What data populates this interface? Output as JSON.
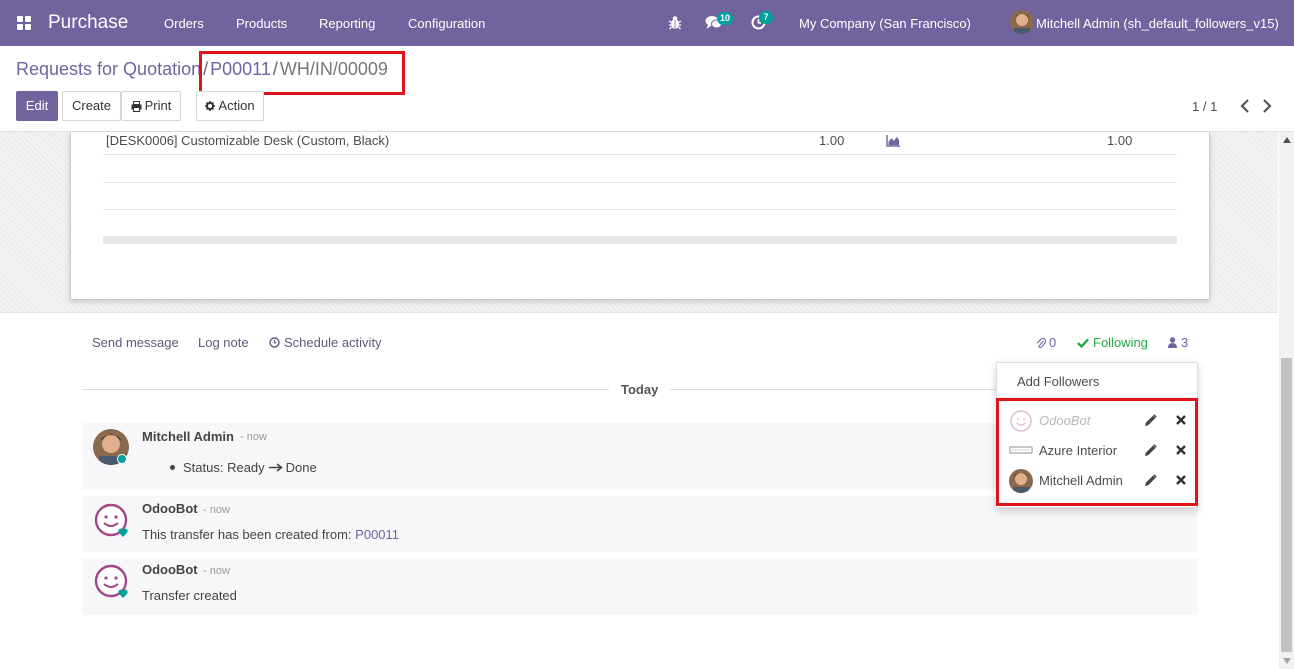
{
  "navbar": {
    "app_name": "Purchase",
    "menu": [
      "Orders",
      "Products",
      "Reporting",
      "Configuration"
    ],
    "messages_badge": "10",
    "activities_badge": "7",
    "company": "My Company (San Francisco)",
    "user": "Mitchell Admin (sh_default_followers_v15)",
    "icons": [
      "apps-icon",
      "bug-icon",
      "chat-icon",
      "clock-icon"
    ]
  },
  "breadcrumb": {
    "root": "Requests for Quotation",
    "parent": "P00011",
    "current": "WH/IN/00009",
    "separator": "/"
  },
  "toolbar": {
    "edit": "Edit",
    "create": "Create",
    "print": "Print",
    "action": "Action"
  },
  "pager": {
    "value": "1 / 1"
  },
  "lines": [
    {
      "product": "[DESK0006] Customizable Desk (Custom, Black)",
      "qty_demand": "1.00",
      "qty_done": "1.00"
    }
  ],
  "chatter": {
    "send_message": "Send message",
    "log_note": "Log note",
    "schedule_activity": "Schedule activity",
    "attachments_count": "0",
    "following_label": "Following",
    "followers_count": "3",
    "date_separator": "Today",
    "messages": [
      {
        "author": "Mitchell Admin",
        "time": "- now",
        "status_text": "Status: Ready",
        "status_new": "Done"
      },
      {
        "author": "OdooBot",
        "time": "- now",
        "body": "This transfer has been created from:",
        "link": "P00011"
      },
      {
        "author": "OdooBot",
        "time": "- now",
        "body": "Transfer created"
      }
    ]
  },
  "followers_dropdown": {
    "add_followers": "Add Followers",
    "followers": [
      {
        "name": "OdooBot",
        "inactive": true
      },
      {
        "name": "Azure Interior",
        "inactive": false
      },
      {
        "name": "Mitchell Admin",
        "inactive": false
      }
    ]
  },
  "colors": {
    "brand": "#71639e",
    "highlight": "#e0131a",
    "following": "#28a745",
    "online": "#00a09d"
  }
}
